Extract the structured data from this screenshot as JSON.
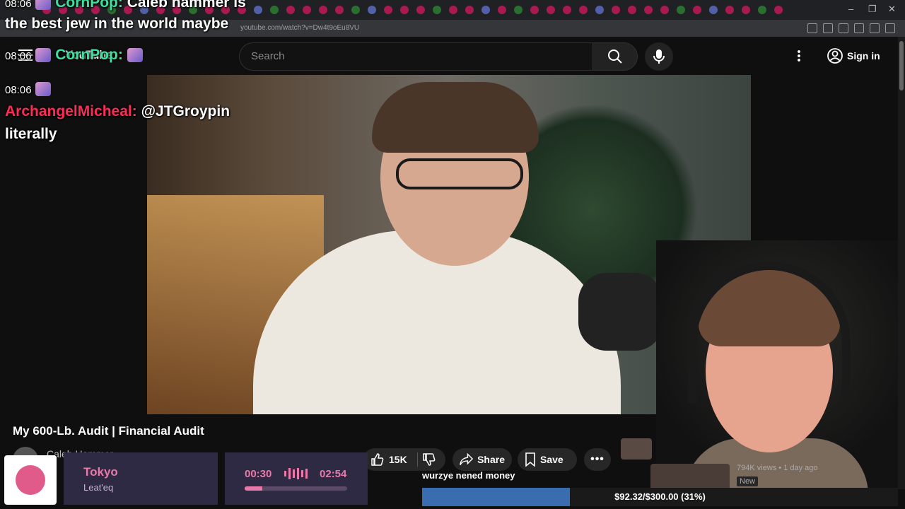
{
  "browser": {
    "url": "youtube.com/watch?v=Dw4t9oEu8VU",
    "window_controls": [
      "–",
      "❐",
      "✕"
    ]
  },
  "header": {
    "logo": "YouTube",
    "search_placeholder": "Search",
    "signin_label": "Sign in"
  },
  "video": {
    "title": "My 600-Lb. Audit | Financial Audit",
    "channel": "Caleb Hammer"
  },
  "actions": {
    "likes": "15K",
    "share_label": "Share",
    "save_label": "Save"
  },
  "chat": [
    {
      "time": "08:06",
      "user": "CornPop:",
      "text": "Caleb hammer is the best jew in the world maybe"
    },
    {
      "time": "08:06",
      "user": "CornPop:",
      "text": ""
    },
    {
      "time": "08:06",
      "user": "ArchangelMicheal:",
      "text": "@JTGroypin literally"
    }
  ],
  "chat_text_line1": "Caleb hammer is",
  "chat_text_line2": "the best jew in the world maybe",
  "chat_arch_mention": "@JTGroypin",
  "chat_arch_line2": "literally",
  "recommendation": {
    "views": "794K views • 1 day ago",
    "badge": "New"
  },
  "music_widget": {
    "track": "Tokyo",
    "artist": "Leat'eq",
    "current_time": "00:30",
    "total_time": "02:54",
    "progress": 0.17
  },
  "donation": {
    "label": "wurzye nened money",
    "goal_text": "$92.32/$300.00 (31%)",
    "progress": 0.31
  },
  "colors": {
    "popname": "#3ee0a0",
    "archname": "#ff2a55",
    "music_accent": "#e879a8",
    "goal_fill": "#3a6db0"
  }
}
